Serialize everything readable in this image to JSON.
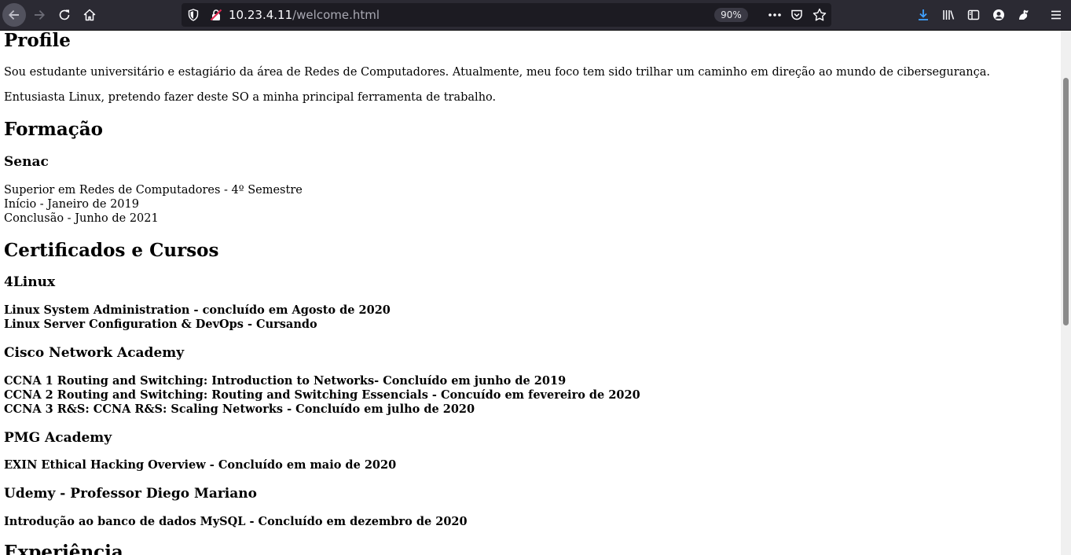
{
  "browser": {
    "url_host": "10.23.4.11",
    "url_path": "/welcome.html",
    "zoom": "90%",
    "icons": [
      "back-arrow-icon",
      "forward-arrow-icon",
      "reload-icon",
      "home-icon",
      "shield-icon",
      "insecure-lock-icon",
      "more-icon",
      "pocket-icon",
      "star-icon",
      "download-icon",
      "library-icon",
      "sidebar-icon",
      "account-icon",
      "extension-icon",
      "menu-icon"
    ]
  },
  "page": {
    "profile": {
      "heading": "Profile",
      "p1": "Sou estudante universitário e estagiário da área de Redes de Computadores. Atualmente, meu foco tem sido trilhar um caminho em direção ao mundo de cibersegurança.",
      "p2": "Entusiasta Linux, pretendo fazer deste SO a minha principal ferramenta de trabalho."
    },
    "formacao": {
      "heading": "Formação",
      "institution": "Senac",
      "lines": [
        "Superior em Redes de Computadores - 4º Semestre",
        "Início - Janeiro de 2019",
        "Conclusão - Junho de 2021"
      ]
    },
    "certificados": {
      "heading": "Certificados e Cursos",
      "groups": [
        {
          "name": "4Linux",
          "items": [
            "Linux System Administration - concluído em Agosto de 2020",
            "Linux Server Configuration & DevOps - Cursando"
          ]
        },
        {
          "name": "Cisco Network Academy",
          "items": [
            "CCNA 1 Routing and Switching: Introduction to Networks- Concluído em junho de 2019",
            "CCNA 2 Routing and Switching: Routing and Switching Essencials - Concuído em fevereiro de 2020",
            "CCNA 3 R&S: CCNA R&S: Scaling Networks - Concluído em julho de 2020"
          ]
        },
        {
          "name": "PMG Academy",
          "items": [
            "EXIN Ethical Hacking Overview - Concluído em maio de 2020"
          ]
        },
        {
          "name": "Udemy - Professor Diego Mariano",
          "items": [
            "Introdução ao banco de dados MySQL - Concluído em dezembro de 2020"
          ]
        }
      ]
    },
    "experiencia": {
      "heading": "Experiência"
    }
  }
}
